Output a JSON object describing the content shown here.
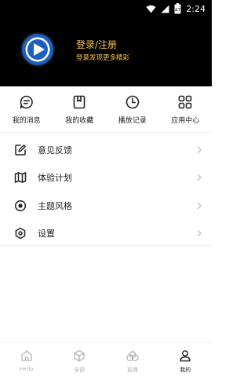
{
  "status_bar": {
    "time": "2:24",
    "battery": "47",
    "icons": [
      "wifi-icon",
      "signal-icon",
      "battery-icon"
    ]
  },
  "profile": {
    "login_title": "登录/注册",
    "login_subtitle": "登录发现更多精彩",
    "avatar_icon": "play-logo-icon",
    "accent_color": "#f3c24e"
  },
  "quick_actions": [
    {
      "label": "我的消息",
      "icon": "message-icon"
    },
    {
      "label": "我的收藏",
      "icon": "bookmark-icon"
    },
    {
      "label": "播放记录",
      "icon": "history-clock-icon"
    },
    {
      "label": "应用中心",
      "icon": "apps-grid-icon"
    }
  ],
  "menu": [
    {
      "label": "意见反馈",
      "icon": "feedback-edit-icon"
    },
    {
      "label": "体验计划",
      "icon": "map-icon"
    },
    {
      "label": "主题风格",
      "icon": "theme-radio-icon"
    },
    {
      "label": "设置",
      "icon": "settings-hexagon-icon"
    }
  ],
  "tabs": [
    {
      "label": "Hello",
      "icon": "home-icon",
      "active": false
    },
    {
      "label": "全部",
      "icon": "cube-icon",
      "active": false
    },
    {
      "label": "直播",
      "icon": "live-icon",
      "active": false
    },
    {
      "label": "我的",
      "icon": "user-icon",
      "active": true
    }
  ]
}
